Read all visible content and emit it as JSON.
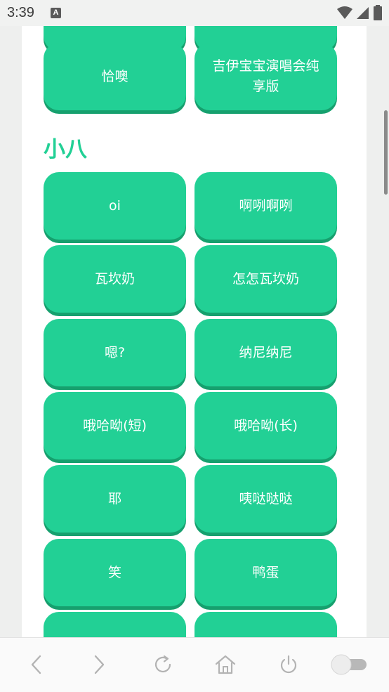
{
  "status_bar": {
    "time": "3:39",
    "notification_badge": "A"
  },
  "top_partial_buttons": [
    "",
    ""
  ],
  "row_top": [
    "恰噢",
    "吉伊宝宝演唱会纯享版"
  ],
  "section": {
    "title": "小八",
    "buttons": [
      "oi",
      "啊咧啊咧",
      "瓦坎奶",
      "怎怎瓦坎奶",
      "嗯?",
      "纳尼纳尼",
      "哦哈呦(短)",
      "哦哈呦(长)",
      "耶",
      "咦哒哒哒",
      "笑",
      "鸭蛋",
      "",
      ""
    ]
  },
  "bottom_nav": {
    "items": [
      "back-icon",
      "forward-icon",
      "refresh-icon",
      "home-icon",
      "power-icon",
      "toggle-switch"
    ]
  },
  "colors": {
    "accent": "#22d095",
    "accent_shadow": "#16a06e"
  }
}
